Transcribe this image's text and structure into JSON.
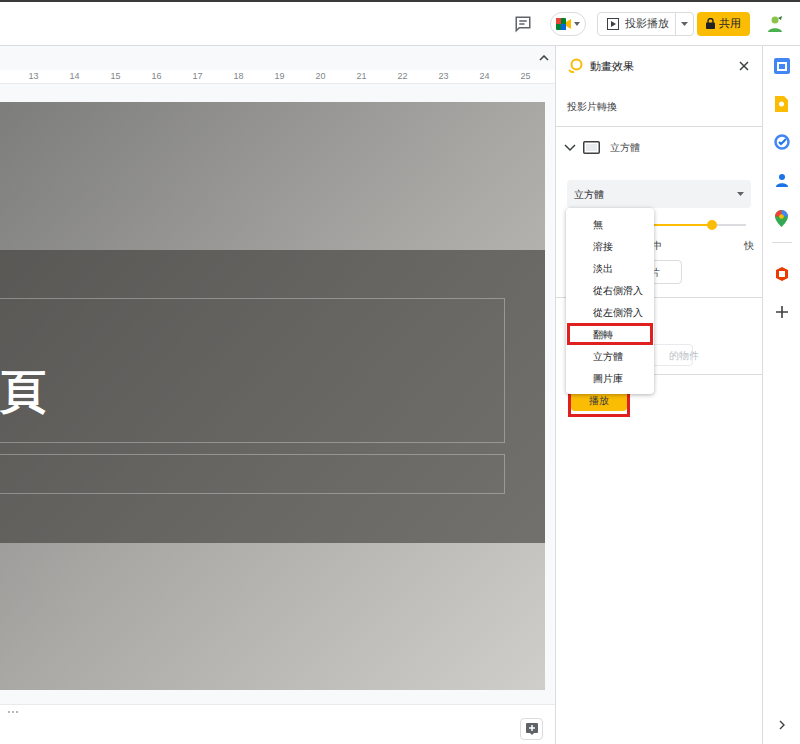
{
  "toolbar": {
    "present_button": {
      "label": "投影播放"
    },
    "share_button": {
      "label": "共用"
    }
  },
  "ruler": {
    "ticks": [
      "13",
      "14",
      "15",
      "16",
      "17",
      "18",
      "19",
      "20",
      "21",
      "22",
      "23",
      "24",
      "25"
    ]
  },
  "slide": {
    "title_fragment": "頁"
  },
  "panel": {
    "title": "動畫效果",
    "section": "投影片轉換",
    "transition": {
      "name": "立方體",
      "expanded": true
    },
    "select": {
      "value": "立方體"
    },
    "speed": {
      "level": 0.8,
      "labels": [
        "中",
        "快"
      ]
    },
    "apply_fragment": "片",
    "object_fragment": "的物件",
    "play_button": {
      "label": "播放",
      "annotated": true
    }
  },
  "menu": {
    "items": [
      {
        "label": "無",
        "annotated": false
      },
      {
        "label": "溶接",
        "annotated": false
      },
      {
        "label": "淡出",
        "annotated": false
      },
      {
        "label": "從右側滑入",
        "annotated": false
      },
      {
        "label": "從左側滑入",
        "annotated": false
      },
      {
        "label": "翻轉",
        "annotated": true
      },
      {
        "label": "立方體",
        "annotated": false
      },
      {
        "label": "圖片庫",
        "annotated": false
      }
    ]
  }
}
